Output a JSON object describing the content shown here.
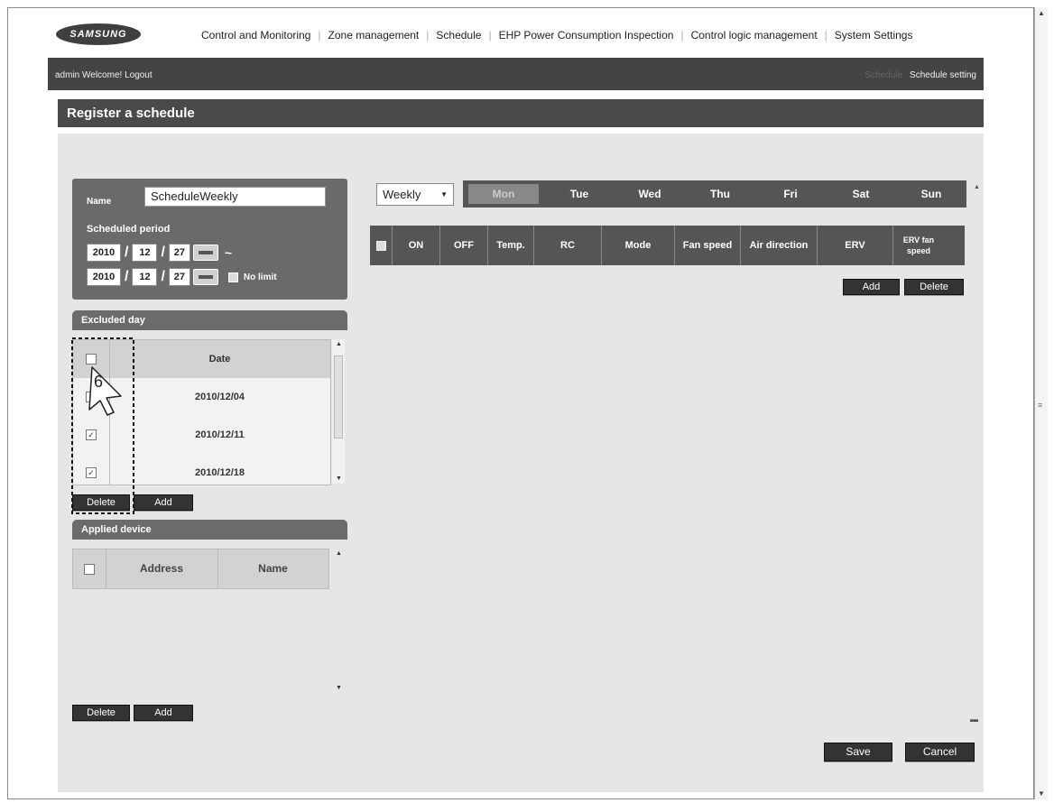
{
  "header": {
    "logo_text": "SAMSUNG",
    "nav": [
      "Control and Monitoring",
      "Zone management",
      "Schedule",
      "EHP Power Consumption Inspection",
      "Control logic management",
      "System Settings"
    ]
  },
  "topbar": {
    "welcome": "admin Welcome! Logout",
    "crumb_parent": "Schedule",
    "crumb_current": "Schedule setting"
  },
  "page": {
    "title": "Register a schedule"
  },
  "form": {
    "name_label": "Name",
    "name_value": "ScheduleWeekly",
    "period_label": "Scheduled period",
    "start": {
      "year": "2010",
      "month": "12",
      "day": "27"
    },
    "end": {
      "year": "2010",
      "month": "12",
      "day": "27"
    },
    "no_limit_label": "No limit",
    "dash": "~",
    "slash": "/"
  },
  "excluded": {
    "title": "Excluded day",
    "header": "Date",
    "rows": [
      {
        "date": "2010/12/04",
        "checked": ""
      },
      {
        "date": "2010/12/11",
        "checked": "✓"
      },
      {
        "date": "2010/12/18",
        "checked": "✓"
      }
    ],
    "delete_label": "Delete",
    "add_label": "Add"
  },
  "annotation": {
    "step": "6"
  },
  "devices": {
    "title": "Applied device",
    "col_address": "Address",
    "col_name": "Name",
    "delete_label": "Delete",
    "add_label": "Add"
  },
  "schedule": {
    "period_select": "Weekly",
    "days": [
      "Mon",
      "Tue",
      "Wed",
      "Thu",
      "Fri",
      "Sat",
      "Sun"
    ],
    "active_day": "Mon",
    "columns": [
      "ON",
      "OFF",
      "Temp.",
      "RC",
      "Mode",
      "Fan speed",
      "Air direction",
      "ERV",
      "ERV fan speed"
    ],
    "add_label": "Add",
    "delete_label": "Delete"
  },
  "footer": {
    "save_label": "Save",
    "cancel_label": "Cancel"
  },
  "colors": {
    "dark_bar": "#444444",
    "panel": "#e6e6e6",
    "header": "#555555"
  }
}
